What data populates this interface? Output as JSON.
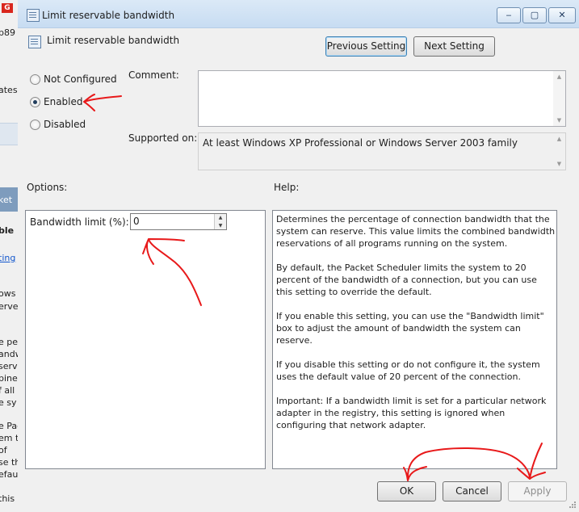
{
  "window": {
    "title": "Limit reservable bandwidth",
    "minimize_glyph": "‒",
    "maximize_glyph": "▢",
    "close_glyph": "✕"
  },
  "background_window_fragments": [
    "b89",
    "ates",
    "ket",
    "ble",
    "ting",
    "ows",
    "erve",
    "e pe",
    "andw",
    "serv",
    "bine",
    "f all",
    "e sy",
    "e Pac",
    "em t",
    "of",
    "se th",
    "efau",
    "this"
  ],
  "header": {
    "policy_icon": "policy-setting-icon",
    "title": "Limit reservable bandwidth",
    "previous_label": "Previous Setting",
    "next_label": "Next Setting"
  },
  "state": {
    "options": [
      "Not Configured",
      "Enabled",
      "Disabled"
    ],
    "selected": "Enabled"
  },
  "comment": {
    "label": "Comment:",
    "value": ""
  },
  "supported": {
    "label": "Supported on:",
    "value": "At least Windows XP Professional or Windows Server 2003 family"
  },
  "options_section": {
    "label": "Options:",
    "bandwidth_label": "Bandwidth limit (%):",
    "bandwidth_value": "0"
  },
  "help_section": {
    "label": "Help:",
    "paragraphs": [
      "Determines the percentage of connection bandwidth that the system can reserve. This value limits the combined bandwidth reservations of all programs running on the system.",
      "By default, the Packet Scheduler limits the system to 20 percent of the bandwidth of a connection, but you can use this setting to override the default.",
      "If you enable this setting, you can use the \"Bandwidth limit\" box to adjust the amount of bandwidth the system can reserve.",
      "If you disable this setting or do not configure it, the system uses the default value of 20 percent of the connection.",
      "Important: If a bandwidth limit is set for a particular network adapter in the registry, this setting is ignored when configuring that network adapter."
    ]
  },
  "footer": {
    "ok_label": "OK",
    "cancel_label": "Cancel",
    "apply_label": "Apply"
  },
  "colors": {
    "annotation_ink": "#e8191a",
    "client_background": "#f0f0f0",
    "titlebar": "#d3e4f5"
  }
}
